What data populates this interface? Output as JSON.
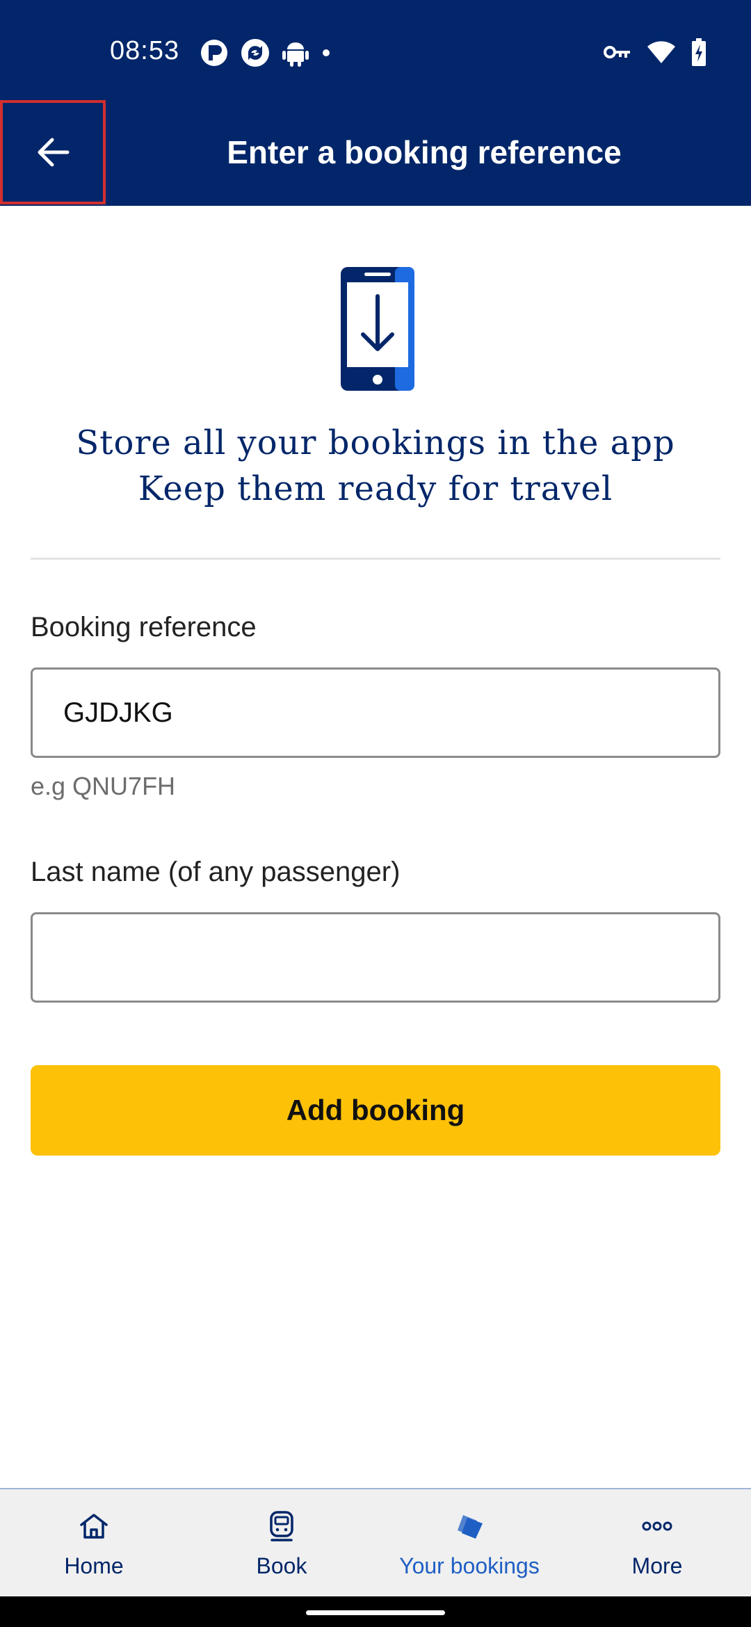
{
  "status_bar": {
    "time": "08:53",
    "icons_left": [
      "app-p-icon",
      "sync-app-icon",
      "android-icon",
      "dot-icon"
    ],
    "icons_right": [
      "vpn-key-icon",
      "wifi-icon",
      "battery-charging-icon"
    ]
  },
  "header": {
    "back_icon": "arrow-left-icon",
    "title": "Enter a booking reference"
  },
  "hero": {
    "icon": "phone-download-icon",
    "line1": "Store all your bookings in the app",
    "line2": "Keep them ready for travel"
  },
  "form": {
    "booking_reference": {
      "label": "Booking reference",
      "value": "GJDJKG",
      "hint": "e.g QNU7FH"
    },
    "last_name": {
      "label": "Last name (of any passenger)",
      "value": ""
    },
    "submit_label": "Add booking"
  },
  "bottom_nav": {
    "items": [
      {
        "label": "Home",
        "icon": "home-icon",
        "active": false
      },
      {
        "label": "Book",
        "icon": "train-icon",
        "active": false
      },
      {
        "label": "Your bookings",
        "icon": "tickets-icon",
        "active": true
      },
      {
        "label": "More",
        "icon": "more-dots-icon",
        "active": false
      }
    ]
  },
  "colors": {
    "brand_navy": "#022669",
    "accent_yellow": "#fdc107",
    "active_blue": "#1f5fc4",
    "highlight_red": "#d32f2f"
  }
}
